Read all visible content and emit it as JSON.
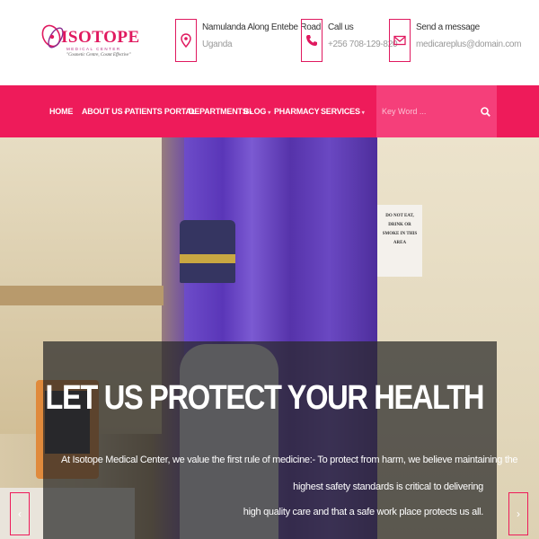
{
  "brand": {
    "name": "ISOTOPE",
    "subtitle": "MEDICAL CENTER",
    "tagline": "\"Cosmetic Centre, Cosmt Effective\"",
    "primary_color": "#ee1b5a"
  },
  "contacts": [
    {
      "icon": "map-pin-icon",
      "line1": "Namulanda Along Entebe Road",
      "line2": "Uganda"
    },
    {
      "icon": "phone-icon",
      "line1": "Call us",
      "line2": "+256 708-129-820"
    },
    {
      "icon": "envelope-icon",
      "line1": "Send a message",
      "line2": "medicareplus@domain.com"
    }
  ],
  "nav": {
    "items": [
      {
        "label": "HOME",
        "dropdown": false
      },
      {
        "label": "ABOUT US",
        "dropdown": true
      },
      {
        "label": "PATIENTS PORTAL",
        "dropdown": false
      },
      {
        "label": "DEPARTMENTS",
        "dropdown": true
      },
      {
        "label": "BLOG",
        "dropdown": true
      },
      {
        "label": "PHARMACY",
        "dropdown": false
      },
      {
        "label": "SERVICES",
        "dropdown": true
      }
    ],
    "search_placeholder": "Key Word ...",
    "search_icon": "search-icon"
  },
  "hero": {
    "sign_text": "DO NOT EAT, DRINK OR SMOKE IN THIS AREA",
    "title": "LET US PROTECT YOUR HEALTH",
    "text_lines": [
      "At Isotope Medical Center, we value the first rule of medicine:- To protect from harm, we believe maintaining the",
      "highest safety standards is critical to delivering",
      "high quality care and that a safe work place protects us all."
    ],
    "prev_icon": "chevron-left-icon",
    "next_icon": "chevron-right-icon"
  }
}
